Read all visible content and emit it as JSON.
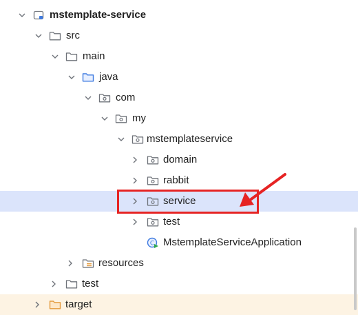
{
  "tree": {
    "root_label": "mstemplate-service",
    "items": [
      {
        "label": "src"
      },
      {
        "label": "main"
      },
      {
        "label": "java"
      },
      {
        "label": "com"
      },
      {
        "label": "my"
      },
      {
        "label": "mstemplateservice"
      },
      {
        "label": "domain"
      },
      {
        "label": "rabbit"
      },
      {
        "label": "service"
      },
      {
        "label": "test"
      },
      {
        "label": "MstemplateServiceApplication"
      },
      {
        "label": "resources"
      },
      {
        "label": "test"
      },
      {
        "label": "target"
      }
    ]
  },
  "colors": {
    "selected_row": "#dbe4fb",
    "excluded_row": "#fdf3e3",
    "annotation": "#e62323",
    "source_folder": "#3f7be0",
    "excluded_folder": "#e39a3c"
  }
}
